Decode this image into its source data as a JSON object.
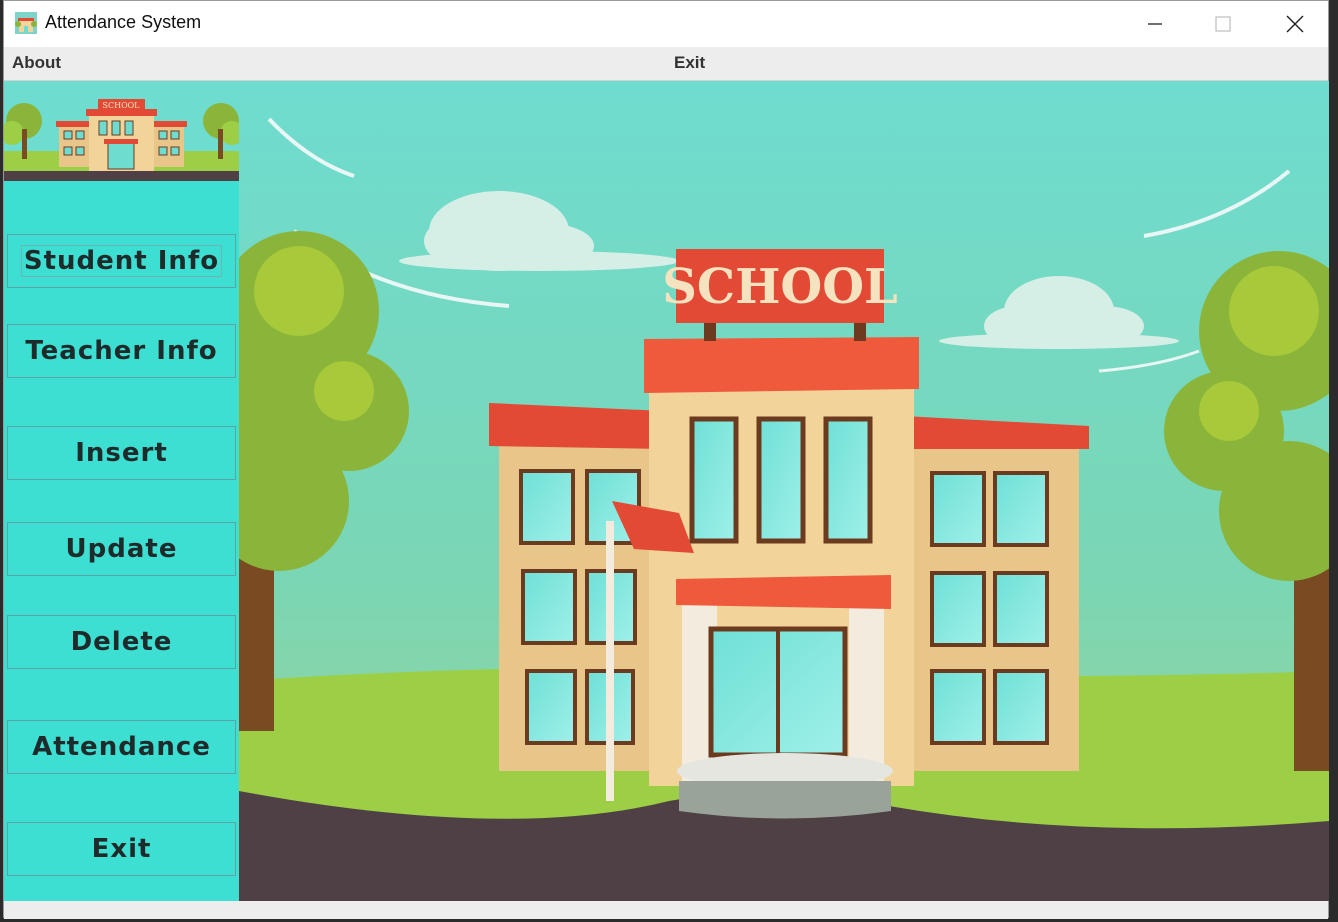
{
  "window": {
    "title": "Attendance System"
  },
  "menubar": {
    "items": [
      "About",
      "Exit"
    ]
  },
  "sidebar": {
    "buttons": [
      "Student Info",
      "Teacher Info",
      "Insert",
      "Update",
      "Delete",
      "Attendance",
      "Exit"
    ]
  },
  "banner": {
    "sign_text": "SCHOOL",
    "thumb_sign_text": "SCHOOL"
  },
  "colors": {
    "sidebar": "#3ddfd2",
    "sky": "#6fdcd0",
    "roof": "#e24a35",
    "building": "#f2d49b",
    "grass": "#96c83a",
    "road": "#4e4044"
  }
}
